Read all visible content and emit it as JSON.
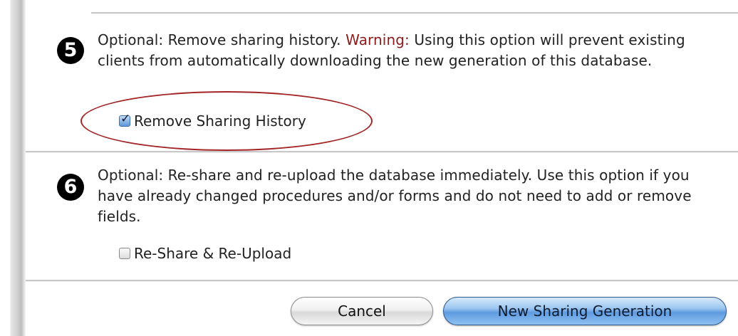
{
  "step5": {
    "number": "5",
    "text_lead": "Optional: Remove sharing history.",
    "warning_label": "Warning:",
    "text_rest": "Using this option will prevent existing clients from automatically downloading the new generation of this database.",
    "checkbox_label": "Remove Sharing History",
    "checkbox_checked": true
  },
  "step6": {
    "number": "6",
    "text": "Optional: Re-share and re-upload the database immediately. Use this option if you have already changed procedures and/or forms and do not need to add or remove fields.",
    "checkbox_label": "Re-Share & Re-Upload",
    "checkbox_checked": false
  },
  "buttons": {
    "cancel_label": "Cancel",
    "primary_label": "New Sharing Generation"
  },
  "colors": {
    "warning": "#8b1c1c",
    "highlight_ellipse": "#a32525",
    "primary_button": "#6aa6e6"
  },
  "icons": {
    "checked_glyph": "✓"
  }
}
